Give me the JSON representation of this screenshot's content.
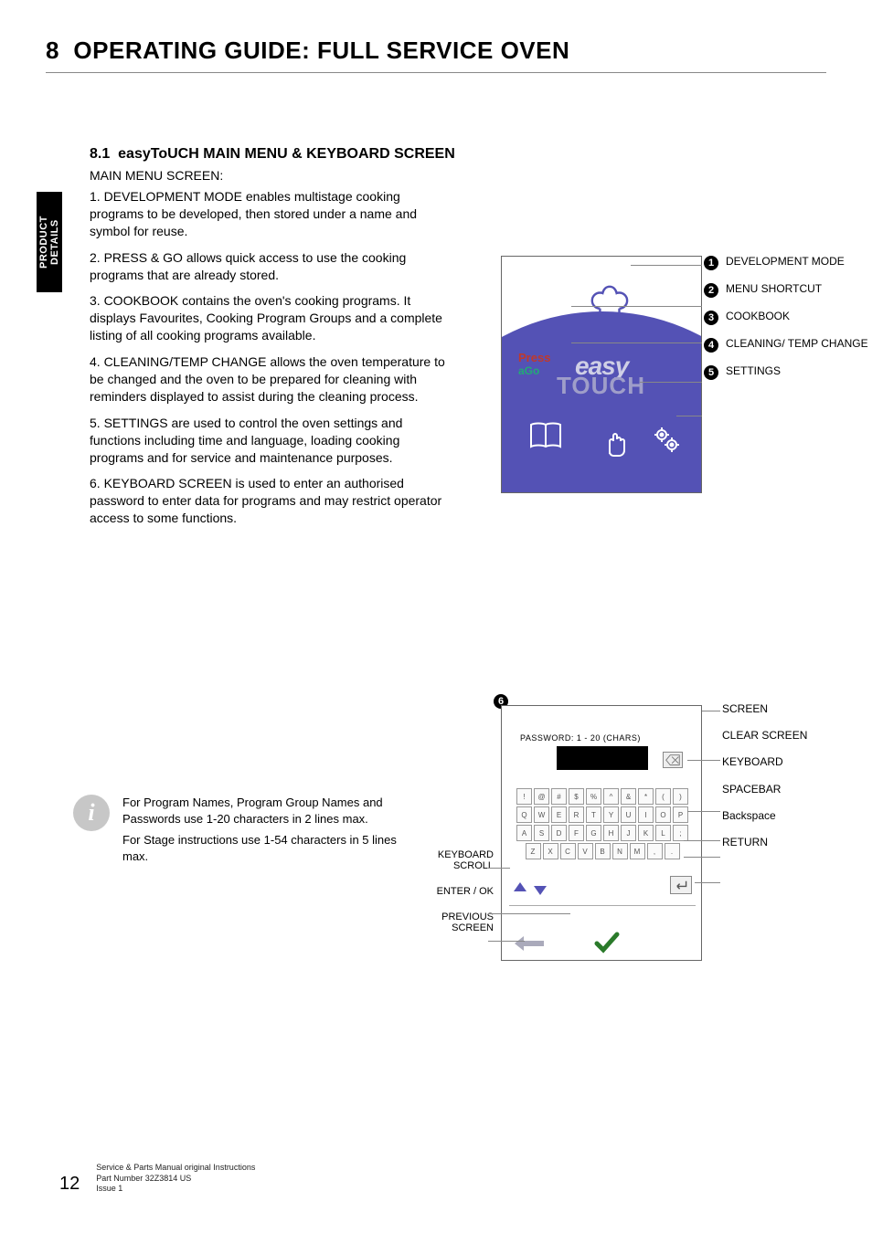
{
  "header": {
    "chapter_num": "8",
    "title": "OPERATING GUIDE: FULL SERVICE OVEN"
  },
  "side_tab": "PRODUCT DETAILS",
  "section": {
    "number": "8.1",
    "title": "easyToUCH MAIN MENU & KEYBOARD SCREEN",
    "subhead": "MAIN MENU SCREEN:",
    "paras": [
      "1. DEVELOPMENT MODE enables multistage cooking programs to be developed, then stored under a name and symbol for reuse.",
      "2. PRESS & GO allows quick access to use the cooking programs that are already stored.",
      "3. COOKBOOK contains the oven's cooking programs. It displays Favourites, Cooking Program Groups and  a complete listing of all cooking programs available.",
      "4. CLEANING/TEMP CHANGE allows the oven temperature to be changed and the oven to be prepared for cleaning with reminders displayed to assist during the cleaning process.",
      "5. SETTINGS are used to control the oven settings and functions including time and language, loading cooking programs and for service and maintenance purposes.",
      "6. KEYBOARD SCREEN is used to enter an authorised password to enter data for programs and may restrict operator access to some functions."
    ]
  },
  "fig1": {
    "press": "Press",
    "ago": "aGo",
    "easy_line1": "easy",
    "easy_line2": "TOUCH",
    "callouts": [
      {
        "n": "1",
        "label": "DEVELOPMENT MODE"
      },
      {
        "n": "2",
        "label": "MENU SHORTCUT"
      },
      {
        "n": "3",
        "label": "COOKBOOK"
      },
      {
        "n": "4",
        "label": "CLEANING/ TEMP CHANGE"
      },
      {
        "n": "5",
        "label": "SETTINGS"
      }
    ]
  },
  "info": {
    "line1": "For Program Names, Program Group Names and Passwords use 1-20 characters in 2 lines max.",
    "line2": "For Stage instructions use 1-54 characters in 5 lines max."
  },
  "fig2": {
    "num": "6",
    "pw_label": "PASSWORD: 1 - 20 (CHARS)",
    "rows": [
      [
        "!",
        "@",
        "#",
        "$",
        "%",
        "^",
        "&",
        "*",
        "(",
        ")"
      ],
      [
        "Q",
        "W",
        "E",
        "R",
        "T",
        "Y",
        "U",
        "I",
        "O",
        "P"
      ],
      [
        "A",
        "S",
        "D",
        "F",
        "G",
        "H",
        "J",
        "K",
        "L",
        ";"
      ],
      [
        "Z",
        "X",
        "C",
        "V",
        "B",
        "N",
        "M",
        ",",
        "."
      ]
    ],
    "left_callouts": [
      "KEYBOARD SCROLL",
      "ENTER / OK",
      "PREVIOUS SCREEN"
    ],
    "right_callouts": [
      "SCREEN",
      "CLEAR SCREEN",
      "KEYBOARD",
      "SPACEBAR",
      "Backspace",
      "RETURN"
    ]
  },
  "footer": {
    "page": "12",
    "l1": "Service & Parts Manual original Instructions",
    "l2": "Part Number 32Z3814 US",
    "l3": "Issue 1"
  }
}
